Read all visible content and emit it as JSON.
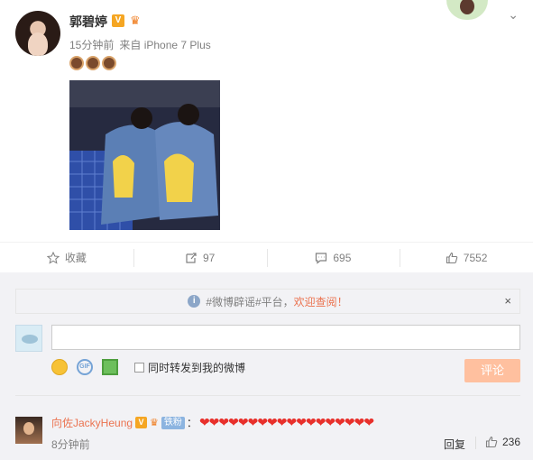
{
  "post": {
    "author": "郭碧婷",
    "verified_badge": "V",
    "time": "15分钟前",
    "source": "来自 iPhone 7 Plus",
    "emoji_count": 3
  },
  "actions": {
    "favorite_label": "收藏",
    "repost_count": "97",
    "comment_count": "695",
    "like_count": "7552"
  },
  "notice": {
    "text_prefix": "#微博辟谣#平台，",
    "text_highlight": "欢迎查阅！",
    "close": "×"
  },
  "composer": {
    "input_value": "",
    "repost_checkbox_label": "同时转发到我的微博",
    "submit_label": "评论"
  },
  "comment": {
    "user": "向佐JackyHeung",
    "verified_badge": "V",
    "fan_badge": "铁粉",
    "colon": "：",
    "hearts": "❤❤❤❤❤❤❤❤❤❤❤❤❤❤❤❤❤❤",
    "time": "8分钟前",
    "reply_label": "回复",
    "like_count": "236"
  },
  "colors": {
    "accent": "#eb7350",
    "submit_disabled": "#ffc09f",
    "verified": "#f5a623"
  }
}
